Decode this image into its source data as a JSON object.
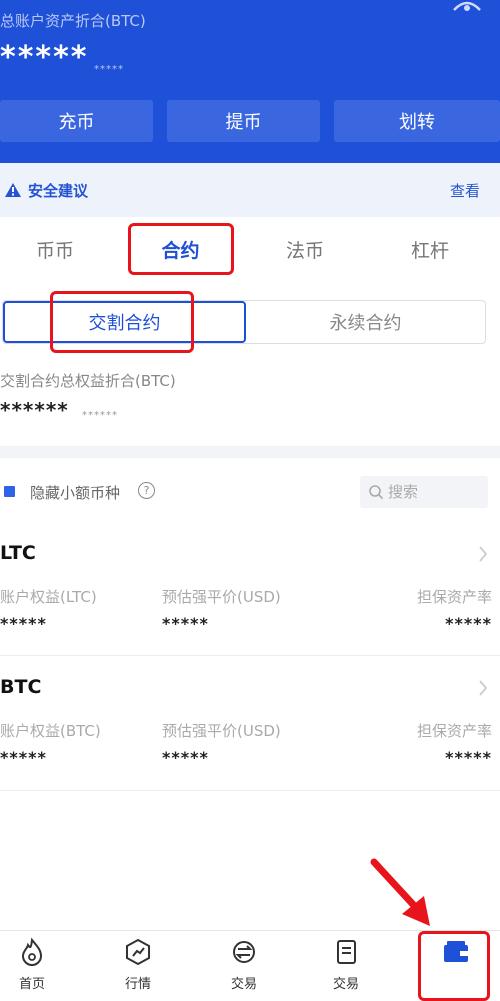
{
  "header": {
    "total_label": "总账户资产折合(BTC)",
    "total_value": "*****",
    "total_sub": "*****",
    "buttons": {
      "deposit": "充币",
      "withdraw": "提币",
      "transfer": "划转"
    }
  },
  "security": {
    "text": "安全建议",
    "view": "查看"
  },
  "tabs": [
    "币币",
    "合约",
    "法币",
    "杠杆"
  ],
  "segment": {
    "delivery": "交割合约",
    "perpetual": "永续合约"
  },
  "delivery_summary": {
    "label": "交割合约总权益折合(BTC)",
    "value": "******",
    "sub": "******"
  },
  "filter": {
    "hide_small": "隐藏小额币种",
    "help": "?",
    "search_placeholder": "搜索"
  },
  "coins": [
    {
      "name": "LTC",
      "col1_label": "账户权益(LTC)",
      "col1_value": "*****",
      "col2_label": "预估强平价(USD)",
      "col2_value": "*****",
      "col3_label": "担保资产率",
      "col3_value": "*****"
    },
    {
      "name": "BTC",
      "col1_label": "账户权益(BTC)",
      "col1_value": "*****",
      "col2_label": "预估强平价(USD)",
      "col2_value": "*****",
      "col3_label": "担保资产率",
      "col3_value": "*****"
    }
  ],
  "bottom_nav": [
    "首页",
    "行情",
    "交易",
    "交易",
    ""
  ],
  "colors": {
    "primary": "#1e50d8",
    "highlight": "#e8141b"
  }
}
